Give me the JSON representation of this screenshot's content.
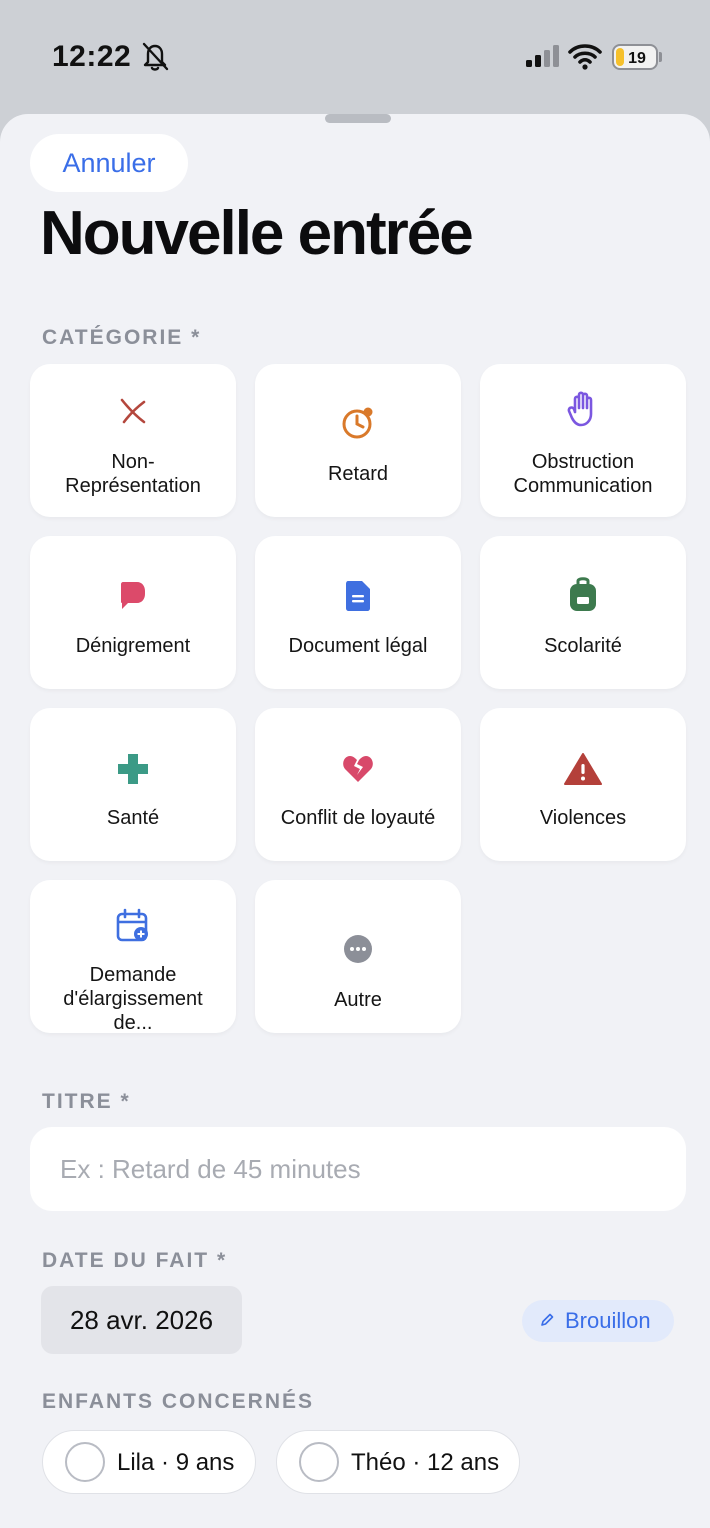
{
  "status_bar": {
    "time": "12:22",
    "battery_level": "19",
    "icons": [
      "bell-slash-icon",
      "signal-icon",
      "wifi-icon",
      "battery-icon"
    ]
  },
  "header": {
    "cancel_label": "Annuler",
    "title": "Nouvelle entrée"
  },
  "category": {
    "label": "CATÉGORIE *",
    "items": [
      {
        "label": "Non-\nReprésentation",
        "icon": "cross-mark-icon",
        "color": "#b4473d"
      },
      {
        "label": "Retard",
        "icon": "clock-alert-icon",
        "color": "#d9792a"
      },
      {
        "label": "Obstruction\nCommunication",
        "icon": "hand-stop-icon",
        "color": "#7b57e0"
      },
      {
        "label": "Dénigrement",
        "icon": "speech-bubble-icon",
        "color": "#dc4a6a"
      },
      {
        "label": "Document légal",
        "icon": "document-icon",
        "color": "#3f6fe0"
      },
      {
        "label": "Scolarité",
        "icon": "backpack-icon",
        "color": "#3d7a4e"
      },
      {
        "label": "Santé",
        "icon": "medical-cross-icon",
        "color": "#3b9a86"
      },
      {
        "label": "Conflit de loyauté",
        "icon": "broken-heart-icon",
        "color": "#d8496a"
      },
      {
        "label": "Violences",
        "icon": "warning-triangle-icon",
        "color": "#b4403a"
      },
      {
        "label": "Demande\nd'élargissement\nde...",
        "icon": "calendar-add-icon",
        "color": "#3f6fe0"
      },
      {
        "label": "Autre",
        "icon": "more-dots-icon",
        "color": "#8c8f98"
      }
    ]
  },
  "title_field": {
    "label": "TITRE *",
    "placeholder": "Ex : Retard de 45 minutes",
    "value": ""
  },
  "date_field": {
    "label": "DATE DU FAIT *",
    "value": "28 avr. 2026",
    "draft_label": "Brouillon"
  },
  "children": {
    "label": "ENFANTS CONCERNÉS",
    "items": [
      {
        "label": "Lila · 9 ans",
        "selected": false
      },
      {
        "label": "Théo · 12 ans",
        "selected": false
      }
    ]
  }
}
